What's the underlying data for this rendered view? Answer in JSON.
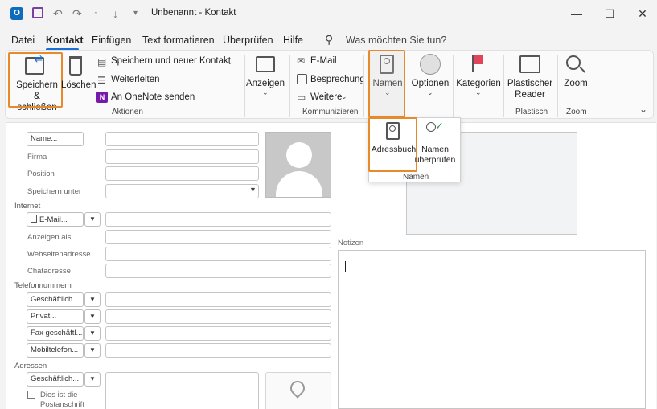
{
  "window": {
    "title": "Unbenannt  -  Kontakt",
    "minimize": "—",
    "maximize": "☐",
    "close": "✕"
  },
  "menu": {
    "items": [
      "Datei",
      "Kontakt",
      "Einfügen",
      "Text formatieren",
      "Überprüfen",
      "Hilfe"
    ],
    "active": "Kontakt",
    "search_placeholder": "Was möchten Sie tun?"
  },
  "ribbon": {
    "aktionen": {
      "group_label": "Aktionen",
      "save_close": [
        "Speichern",
        "& schließen"
      ],
      "delete": "Löschen",
      "save_new": "Speichern und neuer Kontakt",
      "forward": "Weiterleiten",
      "onenote": "An OneNote senden"
    },
    "anzeigen": {
      "label": "Anzeigen"
    },
    "kommunizieren": {
      "group_label": "Kommunizieren",
      "email": "E-Mail",
      "meeting": "Besprechung",
      "more": "Weitere"
    },
    "namen": {
      "label": "Namen"
    },
    "optionen": {
      "label": "Optionen"
    },
    "kategorien": {
      "label": "Kategorien"
    },
    "plastisch": {
      "group_label": "Plastisch",
      "reader": [
        "Plastischer",
        "Reader"
      ]
    },
    "zoom": {
      "group_label": "Zoom",
      "label": "Zoom"
    }
  },
  "dropdown": {
    "adressbuch": "Adressbuch",
    "check_names": [
      "Namen",
      "überprüfen"
    ],
    "group_label": "Namen"
  },
  "form": {
    "name_button": "Name...",
    "firma": "Firma",
    "position": "Position",
    "speichern_unter": "Speichern unter",
    "internet_section": "Internet",
    "email_button": "E-Mail...",
    "anzeigen_als": "Anzeigen als",
    "webseite": "Webseitenadresse",
    "chat": "Chatadresse",
    "telefon_section": "Telefonnummern",
    "phone_types": [
      "Geschäftlich...",
      "Privat...",
      "Fax geschäftl...",
      "Mobiltelefon..."
    ],
    "adressen_section": "Adressen",
    "address_type": "Geschäftlich...",
    "postal_checkbox": [
      "Dies ist die",
      "Postanschrift"
    ],
    "notizen": "Notizen"
  }
}
